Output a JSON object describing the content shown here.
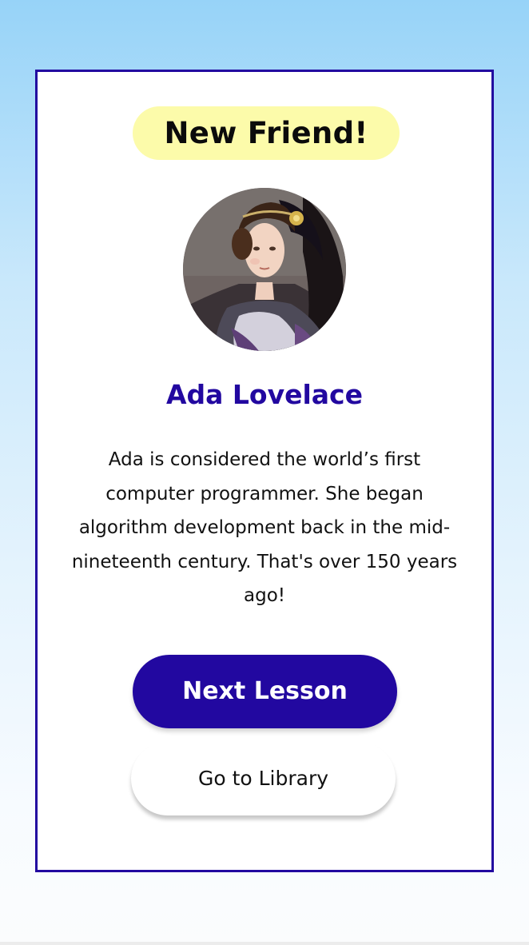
{
  "card": {
    "badge_text": "New Friend!",
    "avatar_alt": "Ada Lovelace portrait",
    "name": "Ada Lovelace",
    "description": "Ada is considered the world’s first computer programmer. She began algorithm development back in the mid-nineteenth century. That's over 150 years ago!"
  },
  "actions": {
    "primary_label": "Next Lesson",
    "secondary_label": "Go to Library"
  },
  "colors": {
    "accent": "#2208a0",
    "badge_background": "#fcfbaa",
    "card_background": "#ffffff"
  }
}
